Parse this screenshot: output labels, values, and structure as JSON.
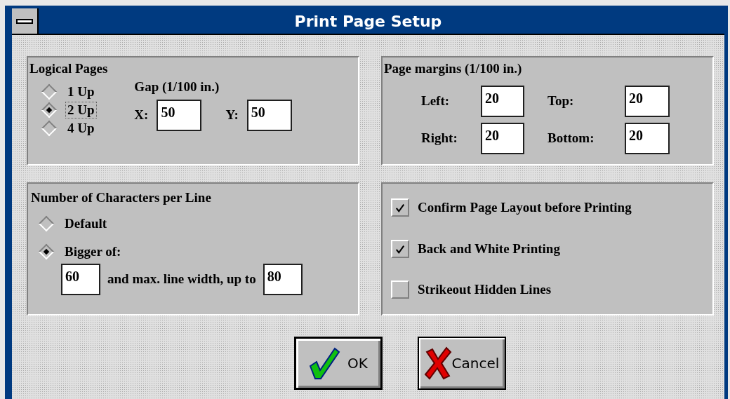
{
  "window": {
    "title": "Print Page Setup"
  },
  "logical_pages": {
    "title": "Logical Pages",
    "options": [
      {
        "label": "1 Up",
        "selected": false,
        "focused": false
      },
      {
        "label": "2 Up",
        "selected": true,
        "focused": true
      },
      {
        "label": "4 Up",
        "selected": false,
        "focused": false
      }
    ],
    "gap": {
      "title": "Gap (1/100 in.)",
      "fields": [
        {
          "label": "X:",
          "value": "50"
        },
        {
          "label": "Y:",
          "value": "50"
        }
      ]
    }
  },
  "page_margins": {
    "title": "Page margins (1/100 in.)",
    "fields": [
      {
        "label": "Left:",
        "value": "20"
      },
      {
        "label": "Top:",
        "value": "20"
      },
      {
        "label": "Right:",
        "value": "20"
      },
      {
        "label": "Bottom:",
        "value": "20"
      }
    ]
  },
  "chars_per_line": {
    "title": "Number of Characters per Line",
    "options": [
      {
        "label": "Default",
        "selected": false
      },
      {
        "label": "Bigger of:",
        "selected": true
      }
    ],
    "min_value": "60",
    "connector": "and max. line width, up to",
    "max_value": "80"
  },
  "print_options": [
    {
      "label": "Confirm Page Layout before Printing",
      "checked": true
    },
    {
      "label": "Back and White Printing",
      "checked": true
    },
    {
      "label": "Strikeout Hidden Lines",
      "checked": false
    }
  ],
  "buttons": [
    {
      "label": "OK",
      "kind": "ok",
      "default": true
    },
    {
      "label": "Cancel",
      "kind": "cancel",
      "default": false
    }
  ]
}
